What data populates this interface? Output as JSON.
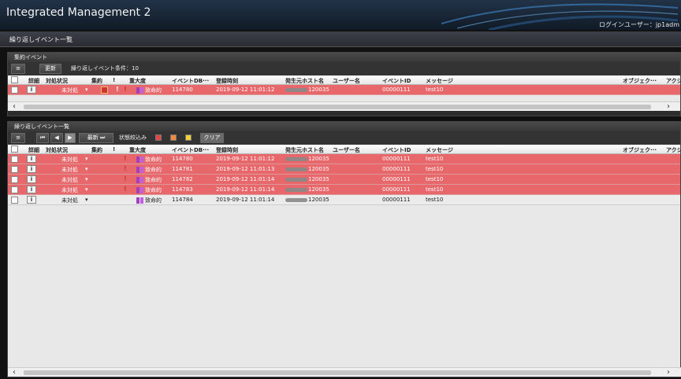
{
  "app": {
    "title": "Integrated Management 2",
    "login_label": "ログインユーザー：jp1adm"
  },
  "screen_title": "繰り返しイベント一覧",
  "aggregated": {
    "title": "集約イベント",
    "refresh_label": "更新",
    "condition_text": "繰り返しイベント条件：10"
  },
  "columns": {
    "detail": "詳細",
    "status": "対処状況",
    "aggregate": "集約",
    "flag": "!",
    "severity": "重大度",
    "event_db": "イベントDB···",
    "registered": "登録時刻",
    "host": "発生元ホスト名",
    "user": "ユーザー名",
    "event_id": "イベントID",
    "message": "メッセージ",
    "object": "オブジェク···",
    "action": "アクシ"
  },
  "aggregated_rows": [
    {
      "status": "未対処",
      "severity": "致命的",
      "event_db": "114780",
      "registered": "2019-09-12 11:01:12",
      "host_suffix": "120035",
      "event_id": "00000111",
      "message": "test10",
      "highlight": true
    }
  ],
  "repeat": {
    "title": "繰り返しイベント一覧",
    "latest_label": "最新",
    "state_filter_label": "状態絞込み",
    "clear_label": "クリア",
    "filter_colors": [
      "#e04848",
      "#f08a3c",
      "#f2d23c"
    ]
  },
  "repeat_rows": [
    {
      "status": "未対処",
      "severity": "致命的",
      "event_db": "114780",
      "registered": "2019-09-12 11:01:12",
      "host_suffix": "120035",
      "event_id": "00000111",
      "message": "test10",
      "highlight": true
    },
    {
      "status": "未対処",
      "severity": "致命的",
      "event_db": "114781",
      "registered": "2019-09-12 11:01:13",
      "host_suffix": "120035",
      "event_id": "00000111",
      "message": "test10",
      "highlight": true
    },
    {
      "status": "未対処",
      "severity": "致命的",
      "event_db": "114782",
      "registered": "2019-09-12 11:01:14",
      "host_suffix": "120035",
      "event_id": "00000111",
      "message": "test10",
      "highlight": true
    },
    {
      "status": "未対処",
      "severity": "致命的",
      "event_db": "114783",
      "registered": "2019-09-12 11:01:14",
      "host_suffix": "120035",
      "event_id": "00000111",
      "message": "test10",
      "highlight": true
    },
    {
      "status": "未対処",
      "severity": "致命的",
      "event_db": "114784",
      "registered": "2019-09-12 11:01:14",
      "host_suffix": "120035",
      "event_id": "00000111",
      "message": "test10",
      "highlight": false
    }
  ]
}
